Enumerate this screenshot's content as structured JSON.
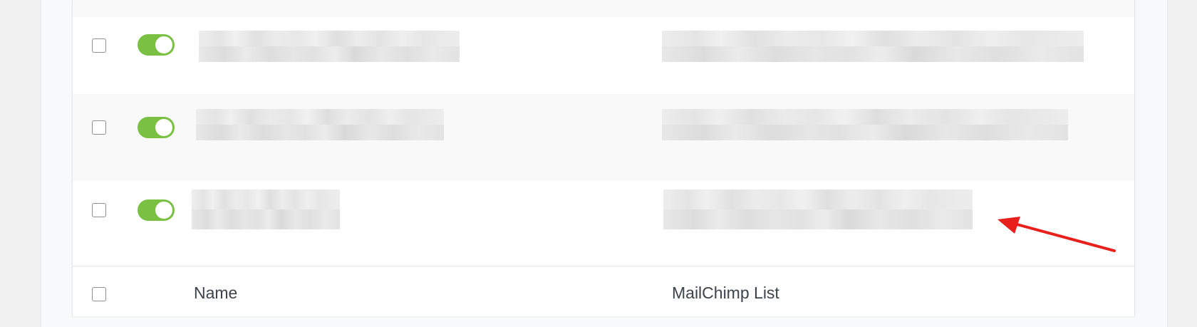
{
  "table": {
    "columns": {
      "name_label": "Name",
      "list_label": "MailChimp List"
    },
    "rows": [
      {
        "enabled": true,
        "name": "",
        "list": ""
      },
      {
        "enabled": true,
        "name": "",
        "list": ""
      },
      {
        "enabled": true,
        "name": "",
        "list": ""
      }
    ]
  },
  "colors": {
    "toggle_on": "#7ac143",
    "annotation_arrow": "#e8201c"
  },
  "annotation": {
    "icon": "red-arrow-icon"
  }
}
